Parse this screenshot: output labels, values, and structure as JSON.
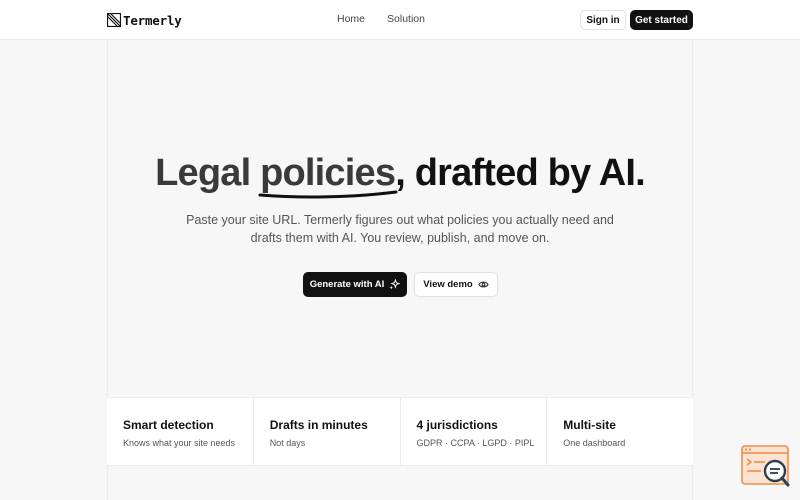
{
  "brand": {
    "name": "Termerly"
  },
  "nav": {
    "items": [
      "Home",
      "Solution"
    ]
  },
  "header": {
    "signin_label": "Sign in",
    "get_started_label": "Get started"
  },
  "hero": {
    "title_part1": "Legal ",
    "title_highlight": "policies",
    "title_part2": ", drafted by AI.",
    "subtitle_line1": "Paste your site URL. Termerly figures out what policies you actually need and",
    "subtitle_line2": "drafts them with AI. You review, publish, and move on.",
    "primary_cta": "Generate with AI",
    "secondary_cta": "View demo"
  },
  "features": [
    {
      "title": "Smart detection",
      "desc": "Knows what your site needs"
    },
    {
      "title": "Drafts in minutes",
      "desc": "Not days"
    },
    {
      "title": "4 jurisdictions",
      "desc": "GDPR · CCPA · LGPD · PIPL"
    },
    {
      "title": "Multi-site",
      "desc": "One dashboard"
    }
  ],
  "colors": {
    "primary": "#111111",
    "accent": "#f08a4b",
    "background": "#f7f7f7"
  },
  "icons": {
    "primary_cta": "sparkle-icon",
    "secondary_cta": "eye-icon",
    "floating": "search-terms-icon"
  }
}
